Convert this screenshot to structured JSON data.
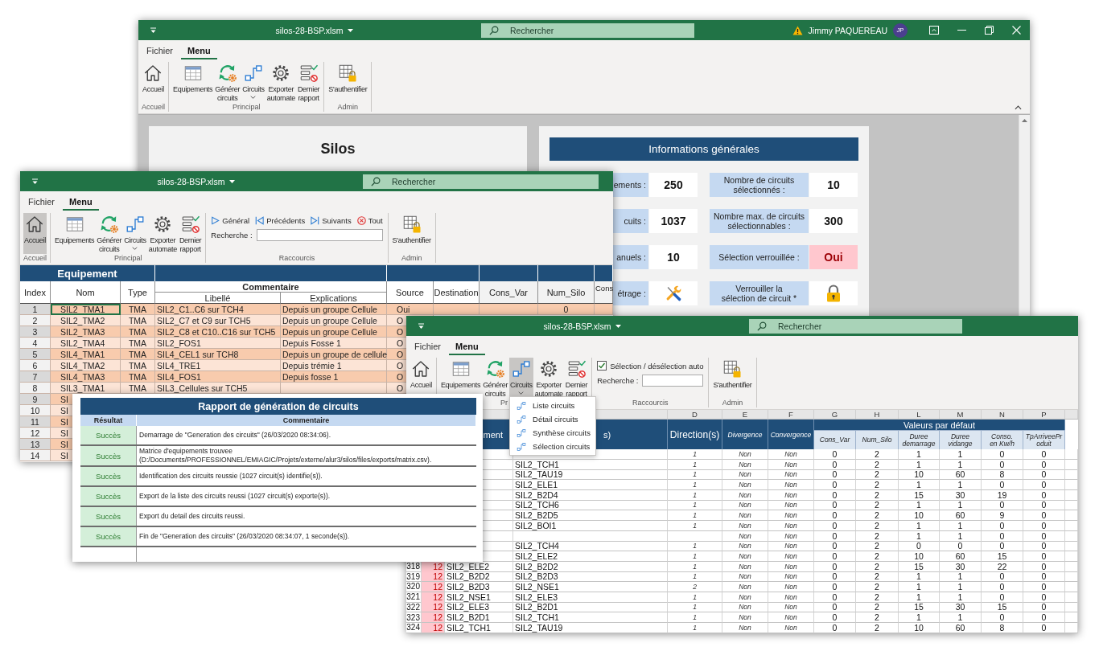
{
  "dashboard_window": {
    "title": "silos-28-BSP.xlsm",
    "search": {
      "placeholder": "Rechercher"
    },
    "user": {
      "name": "Jimmy PAQUEREAU",
      "initials": "JP"
    },
    "tabs": [
      {
        "label": "Fichier",
        "selected": false
      },
      {
        "label": "Menu",
        "selected": true
      }
    ],
    "ribbon": [
      {
        "label": "Accueil",
        "kind": "buttons",
        "buttons": [
          {
            "label": "Accueil",
            "kind": "home",
            "selected": false,
            "dropdown": false
          }
        ]
      },
      {
        "label": "Principal",
        "kind": "buttons",
        "buttons": [
          {
            "label": "Equipements",
            "kind": "table",
            "selected": false,
            "dropdown": false
          },
          {
            "label": "Générer circuits",
            "kind": "generate",
            "selected": false,
            "dropdown": false
          },
          {
            "label": "Circuits",
            "kind": "circuit",
            "selected": false,
            "dropdown": true
          },
          {
            "label": "Exporter automate",
            "kind": "export",
            "selected": false,
            "dropdown": false
          },
          {
            "label": "Dernier rapport",
            "kind": "report",
            "selected": false,
            "dropdown": false
          }
        ]
      },
      {
        "label": "Admin",
        "kind": "buttons",
        "buttons": [
          {
            "label": "S'authentifier",
            "kind": "auth",
            "selected": false,
            "dropdown": false
          }
        ]
      }
    ],
    "title_panel": {
      "title": "Silos"
    },
    "info_panel": {
      "title": "Informations générales",
      "items": [
        {
          "label": "ements :",
          "kind": "text",
          "value": "250",
          "alert": false
        },
        {
          "label": "Nombre de circuits\nsélectionnés :",
          "kind": "text",
          "value": "10",
          "alert": false
        },
        {
          "label": "cuits :",
          "kind": "text",
          "value": "1037",
          "alert": false
        },
        {
          "label": "Nombre max. de circuits\nsélectionnables :",
          "kind": "text",
          "value": "300",
          "alert": false
        },
        {
          "label": "anuels :",
          "kind": "text",
          "value": "10",
          "alert": false
        },
        {
          "label": "Sélection verrouillée :",
          "kind": "text",
          "value": "Oui",
          "alert": true
        },
        {
          "label": "étrage :",
          "kind": "tools",
          "alert": false
        },
        {
          "label": "Verrouiller la\nsélection de circuit *",
          "kind": "lock",
          "alert": false
        }
      ]
    }
  },
  "equipment_window": {
    "title": "silos-28-BSP.xlsm",
    "search": {
      "placeholder": "Rechercher"
    },
    "tabs": [
      {
        "label": "Fichier",
        "selected": false
      },
      {
        "label": "Menu",
        "selected": true
      }
    ],
    "ribbon": [
      {
        "label": "Accueil",
        "kind": "buttons",
        "buttons": [
          {
            "label": "Accueil",
            "kind": "home",
            "selected": true,
            "dropdown": false
          }
        ]
      },
      {
        "label": "Principal",
        "kind": "buttons",
        "buttons": [
          {
            "label": "Equipements",
            "kind": "table",
            "selected": false,
            "dropdown": false
          },
          {
            "label": "Générer circuits",
            "kind": "generate",
            "selected": false,
            "dropdown": false
          },
          {
            "label": "Circuits",
            "kind": "circuit",
            "selected": false,
            "dropdown": true
          },
          {
            "label": "Exporter automate",
            "kind": "export",
            "selected": false,
            "dropdown": false
          },
          {
            "label": "Dernier rapport",
            "kind": "report",
            "selected": false,
            "dropdown": false
          }
        ]
      },
      {
        "label": "Raccourcis",
        "kind": "shortcuts",
        "links": [
          {
            "label": "Général",
            "kind": "first"
          },
          {
            "label": "Précédents",
            "kind": "previous"
          },
          {
            "label": "Suivants",
            "kind": "next"
          },
          {
            "label": "Tout",
            "kind": "clear"
          }
        ],
        "search_label": "Recherche :"
      },
      {
        "label": "Admin",
        "kind": "buttons",
        "buttons": [
          {
            "label": "S'authentifier",
            "kind": "auth",
            "selected": false,
            "dropdown": false
          }
        ]
      }
    ],
    "table": {
      "title": "Equipement",
      "columns": [
        {
          "label": "Index"
        },
        {
          "label": "Nom"
        },
        {
          "label": "Type"
        },
        {
          "label": "Commentaire",
          "children": [
            {
              "label": "Libellé"
            },
            {
              "label": "Explications"
            }
          ]
        },
        {
          "label": "Source"
        },
        {
          "label": "Destination"
        },
        {
          "label": "Cons_Var"
        },
        {
          "label": "Num_Silo"
        },
        {
          "label": "Cons"
        }
      ],
      "rows": [
        {
          "index": "1",
          "name": "SIL2_TMA1",
          "type": "TMA",
          "label": "SIL2_C1..C6 sur TCH4",
          "explanation": "Depuis un groupe Cellule",
          "source": "Oui",
          "num_silo": "0",
          "selected": true
        },
        {
          "index": "2",
          "name": "SIL2_TMA2",
          "type": "TMA",
          "label": "SIL2_C7 et C9 sur TCH5",
          "explanation": "Depuis un groupe Cellule",
          "source": "O",
          "selected": false
        },
        {
          "index": "3",
          "name": "SIL2_TMA3",
          "type": "TMA",
          "label": "SIL2_C8 et C10..C16 sur TCH5",
          "explanation": "Depuis un groupe Cellule",
          "source": "O",
          "selected": false
        },
        {
          "index": "4",
          "name": "SIL2_TMA4",
          "type": "TMA",
          "label": "SIL2_FOS1",
          "explanation": "Depuis Fosse 1",
          "source": "O",
          "selected": false
        },
        {
          "index": "5",
          "name": "SIL4_TMA1",
          "type": "TMA",
          "label": "SIL4_CEL1 sur TCH8",
          "explanation": "Depuis un groupe de cellule",
          "source": "O",
          "selected": false
        },
        {
          "index": "6",
          "name": "SIL4_TMA2",
          "type": "TMA",
          "label": "SIL4_TRE1",
          "explanation": "Depuis trémie 1",
          "source": "O",
          "selected": false
        },
        {
          "index": "7",
          "name": "SIL4_TMA3",
          "type": "TMA",
          "label": "SIL4_FOS1",
          "explanation": "Depuis fosse 1",
          "source": "O",
          "selected": false
        },
        {
          "index": "8",
          "name": "SIL3_TMA1",
          "type": "TMA",
          "label": "SIL3_Cellules sur TCH5",
          "source": "O",
          "selected": false
        },
        {
          "index": "9",
          "name": "SI",
          "selected": false
        },
        {
          "index": "10",
          "name": "SI",
          "selected": false
        },
        {
          "index": "11",
          "name": "SI",
          "selected": false
        },
        {
          "index": "12",
          "name": "SI",
          "selected": false
        },
        {
          "index": "13",
          "name": "SI",
          "selected": false
        },
        {
          "index": "14",
          "name": "SI",
          "selected": false
        }
      ]
    }
  },
  "circuits_window": {
    "title": "silos-28-BSP.xlsm",
    "search": {
      "placeholder": "Rechercher"
    },
    "tabs": [
      {
        "label": "Fichier",
        "selected": false
      },
      {
        "label": "Menu",
        "selected": true
      }
    ],
    "ribbon": [
      {
        "kind": "buttons",
        "buttons": [
          {
            "label": "Accueil",
            "kind": "home",
            "selected": false,
            "dropdown": false
          }
        ]
      },
      {
        "label": "Pr",
        "kind": "buttons",
        "buttons": [
          {
            "label": "Equipements",
            "kind": "table",
            "selected": false,
            "dropdown": false
          },
          {
            "label": "Générer circuits",
            "kind": "generate",
            "selected": false,
            "dropdown": false
          },
          {
            "label": "Circuits",
            "kind": "circuit",
            "selected": true,
            "dropdown": true,
            "menu": [
              {
                "label": "Liste circuits"
              },
              {
                "label": "Détail circuits"
              },
              {
                "label": "Synthèse circuits"
              },
              {
                "label": "Sélection circuits"
              }
            ]
          },
          {
            "label": "Exporter automate",
            "kind": "export",
            "selected": false,
            "dropdown": false
          },
          {
            "label": "Dernier rapport",
            "kind": "report",
            "selected": false,
            "dropdown": false
          }
        ]
      },
      {
        "label": "Raccourcis",
        "kind": "shortcuts",
        "checkbox": {
          "label": "Sélection / désélection auto",
          "checked": true
        },
        "search_label": "Recherche :"
      },
      {
        "label": "Admin",
        "kind": "buttons",
        "buttons": [
          {
            "label": "S'authentifier",
            "kind": "auth",
            "selected": false,
            "dropdown": false
          }
        ]
      }
    ],
    "sheet": {
      "column_letters": [
        "D",
        "E",
        "F",
        "G",
        "H",
        "L",
        "M",
        "N",
        "P"
      ],
      "headers": {
        "equipment": "ment",
        "circuit": "s)",
        "direction": "Direction(s)",
        "divergence": "Divergence",
        "convergence": "Convergence",
        "defaults": {
          "label": "Valeurs par défaut",
          "columns": [
            "Cons_Var",
            "Num_Silo",
            "Duree\ndemarrage",
            "Duree\nvidange",
            "Conso.\nen Kw/h",
            "TpArriveeProduit"
          ]
        }
      },
      "rows": [
        {
          "direction": "1",
          "divergence": "Non",
          "convergence": "Non",
          "values": [
            "0",
            "2",
            "1",
            "1",
            "0",
            "0"
          ]
        },
        {
          "circuit": "SIL2_TCH1",
          "direction": "1",
          "divergence": "Non",
          "convergence": "Non",
          "values": [
            "0",
            "2",
            "1",
            "1",
            "0",
            "0"
          ]
        },
        {
          "circuit": "SIL2_TAU19",
          "direction": "1",
          "divergence": "Non",
          "convergence": "Non",
          "values": [
            "0",
            "2",
            "10",
            "60",
            "8",
            "0"
          ]
        },
        {
          "circuit": "SIL2_ELE1",
          "direction": "1",
          "divergence": "Non",
          "convergence": "Non",
          "values": [
            "0",
            "2",
            "1",
            "1",
            "0",
            "0"
          ]
        },
        {
          "circuit": "SIL2_B2D4",
          "direction": "1",
          "divergence": "Non",
          "convergence": "Non",
          "values": [
            "0",
            "2",
            "15",
            "30",
            "19",
            "0"
          ]
        },
        {
          "circuit": "SIL2_TCH6",
          "direction": "1",
          "divergence": "Non",
          "convergence": "Non",
          "values": [
            "0",
            "2",
            "1",
            "1",
            "0",
            "0"
          ]
        },
        {
          "circuit": "SIL2_B2D5",
          "direction": "1",
          "divergence": "Non",
          "convergence": "Non",
          "values": [
            "0",
            "2",
            "10",
            "60",
            "9",
            "0"
          ]
        },
        {
          "circuit": "SIL2_BOI1",
          "direction": "1",
          "divergence": "Non",
          "convergence": "Non",
          "values": [
            "0",
            "2",
            "1",
            "1",
            "0",
            "0"
          ]
        },
        {
          "divergence": "Non",
          "convergence": "Non",
          "values": [
            "0",
            "2",
            "1",
            "1",
            "0",
            "0"
          ]
        },
        {
          "circuit": "SIL2_TCH4",
          "direction": "1",
          "divergence": "Non",
          "convergence": "Non",
          "values": [
            "0",
            "2",
            "0",
            "0",
            "0",
            "0"
          ]
        },
        {
          "circuit": "SIL2_ELE2",
          "direction": "1",
          "divergence": "Non",
          "convergence": "Non",
          "values": [
            "0",
            "2",
            "10",
            "60",
            "15",
            "0"
          ]
        },
        {
          "index": "318",
          "group": "12",
          "equipment": "SIL2_ELE2",
          "circuit": "SIL2_B2D2",
          "direction": "1",
          "divergence": "Non",
          "convergence": "Non",
          "values": [
            "0",
            "2",
            "15",
            "30",
            "22",
            "0"
          ]
        },
        {
          "index": "319",
          "group": "12",
          "equipment": "SIL2_B2D2",
          "circuit": "SIL2_B2D3",
          "direction": "1",
          "divergence": "Non",
          "convergence": "Non",
          "values": [
            "0",
            "2",
            "1",
            "1",
            "0",
            "0"
          ]
        },
        {
          "index": "320",
          "group": "12",
          "equipment": "SIL2_B2D3",
          "circuit": "SIL2_NSE1",
          "direction": "2",
          "divergence": "Non",
          "convergence": "Non",
          "values": [
            "0",
            "2",
            "1",
            "1",
            "0",
            "0"
          ]
        },
        {
          "index": "321",
          "group": "12",
          "equipment": "SIL2_NSE1",
          "circuit": "SIL2_ELE3",
          "direction": "1",
          "divergence": "Non",
          "convergence": "Non",
          "values": [
            "0",
            "2",
            "1",
            "1",
            "0",
            "0"
          ]
        },
        {
          "index": "322",
          "group": "12",
          "equipment": "SIL2_ELE3",
          "circuit": "SIL2_B2D1",
          "direction": "1",
          "divergence": "Non",
          "convergence": "Non",
          "values": [
            "0",
            "2",
            "15",
            "30",
            "15",
            "0"
          ]
        },
        {
          "index": "323",
          "group": "12",
          "equipment": "SIL2_B2D1",
          "circuit": "SIL2_TCH1",
          "direction": "1",
          "divergence": "Non",
          "convergence": "Non",
          "values": [
            "0",
            "2",
            "1",
            "1",
            "0",
            "0"
          ]
        },
        {
          "index": "324",
          "group": "12",
          "equipment": "SIL2_TCH1",
          "circuit": "SIL2_TAU19",
          "direction": "1",
          "divergence": "Non",
          "convergence": "Non",
          "values": [
            "0",
            "2",
            "10",
            "60",
            "8",
            "0"
          ]
        }
      ]
    }
  },
  "report_dialog": {
    "title": "Rapport de génération de circuits",
    "columns": [
      "Résultat",
      "Commentaire"
    ],
    "rows": [
      {
        "result": "Succès",
        "kind": "success",
        "comment": "Demarrage de \"Generation des circuits\" (26/03/2020 08:34:06)."
      },
      {
        "result": "Succès",
        "kind": "success",
        "comment": "Matrice d'equipements trouvee\n(D:/Documents/PROFESSIONNEL/EMIAGIC/Projets/externe/alur3/silos/files/exports/matrix.csv)."
      },
      {
        "result": "Succès",
        "kind": "success",
        "comment": "Identification des circuits reussie (1027 circuit(s) identifie(s))."
      },
      {
        "result": "Succès",
        "kind": "success",
        "comment": "Export de la liste des circuits reussi (1027 circuit(s) exporte(s))."
      },
      {
        "result": "Succès",
        "kind": "success",
        "comment": "Export du detail des circuits reussi."
      },
      {
        "result": "Succès",
        "kind": "success",
        "comment": "Fin de \"Generation des circuits\" (26/03/2020 08:34:07, 1 seconde(s))."
      }
    ]
  }
}
